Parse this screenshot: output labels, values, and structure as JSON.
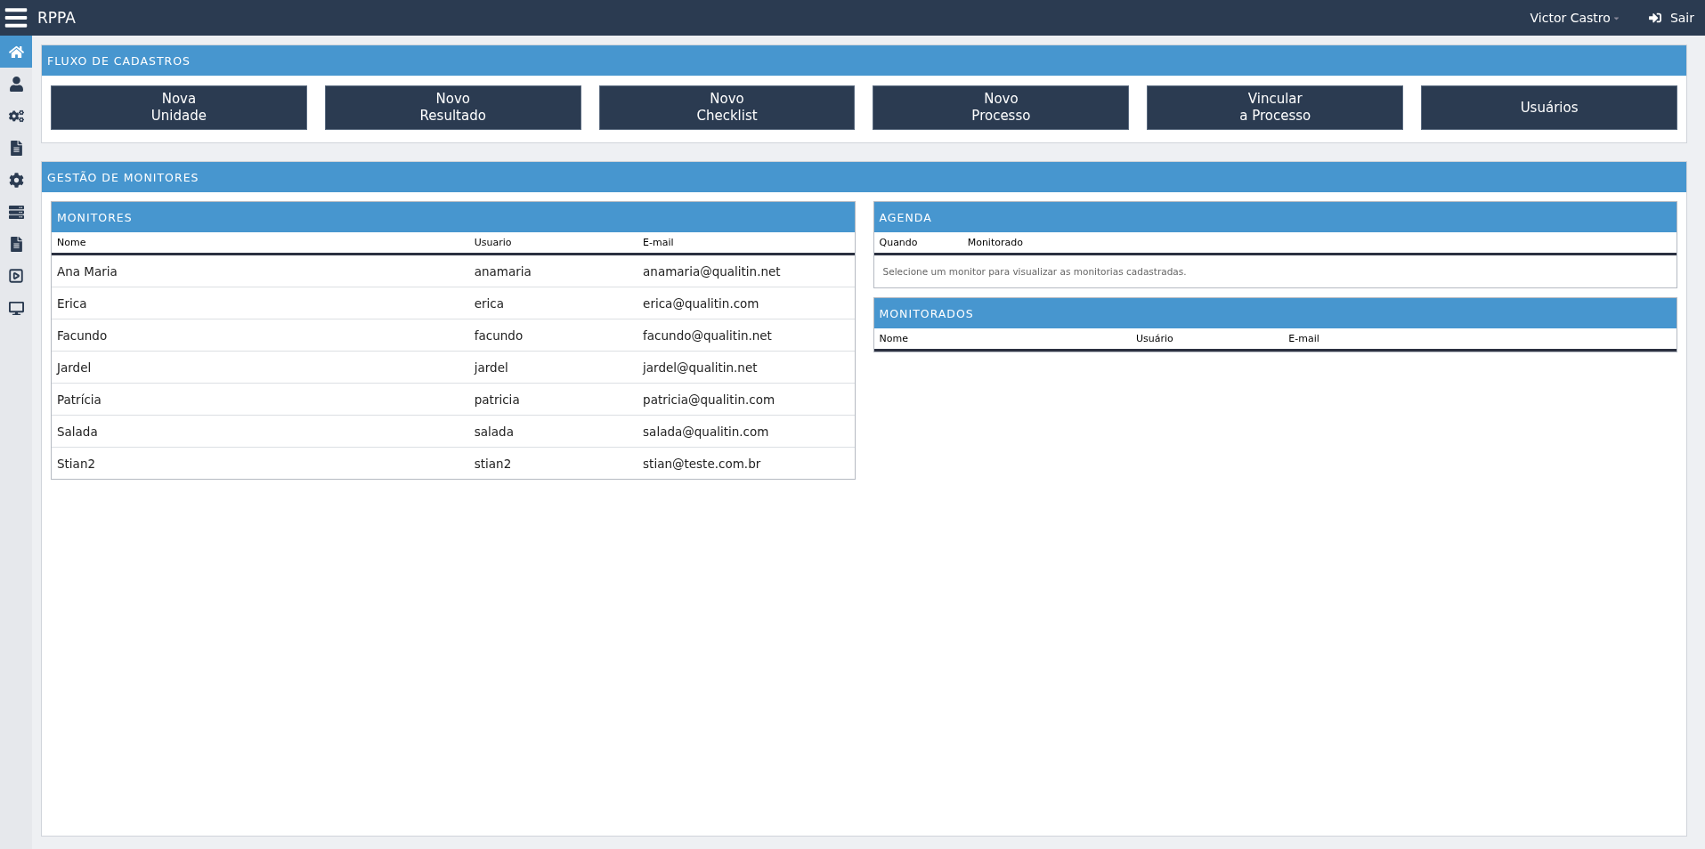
{
  "topbar": {
    "title": "RPPA",
    "user": "Victor Castro",
    "logout": "Sair"
  },
  "sidebar": {
    "items": [
      {
        "selected": true
      },
      {
        "selected": false
      },
      {
        "selected": false
      },
      {
        "selected": false
      },
      {
        "selected": false
      },
      {
        "selected": false
      },
      {
        "selected": false
      },
      {
        "selected": false
      },
      {
        "selected": false
      }
    ]
  },
  "fluxo": {
    "title": "FLUXO DE CADASTROS",
    "buttons": [
      [
        "Nova",
        "Unidade"
      ],
      [
        "Novo",
        "Resultado"
      ],
      [
        "Novo",
        "Checklist"
      ],
      [
        "Novo",
        "Processo"
      ],
      [
        "Vincular",
        "a Processo"
      ],
      [
        "Usuários"
      ]
    ]
  },
  "gestao": {
    "title": "GESTÃO DE MONITORES",
    "monitores": {
      "title": "MONITORES",
      "columns": [
        "Nome",
        "Usuario",
        "E-mail"
      ],
      "rows": [
        [
          "Ana Maria",
          "anamaria",
          "anamaria@qualitin.net"
        ],
        [
          "Erica",
          "erica",
          "erica@qualitin.com"
        ],
        [
          "Facundo",
          "facundo",
          "facundo@qualitin.net"
        ],
        [
          "Jardel",
          "jardel",
          "jardel@qualitin.net"
        ],
        [
          "Patrícia",
          "patricia",
          "patricia@qualitin.com"
        ],
        [
          "Salada",
          "salada",
          "salada@qualitin.com"
        ],
        [
          "Stian2",
          "stian2",
          "stian@teste.com.br"
        ]
      ]
    },
    "agenda": {
      "title": "AGENDA",
      "columns": [
        "Quando",
        "Monitorado"
      ],
      "empty_message": "Selecione um monitor para visualizar as monitorias cadastradas."
    },
    "monitorados": {
      "title": "MONITORADOS",
      "columns": [
        "Nome",
        "Usuário",
        "E-mail"
      ]
    }
  }
}
